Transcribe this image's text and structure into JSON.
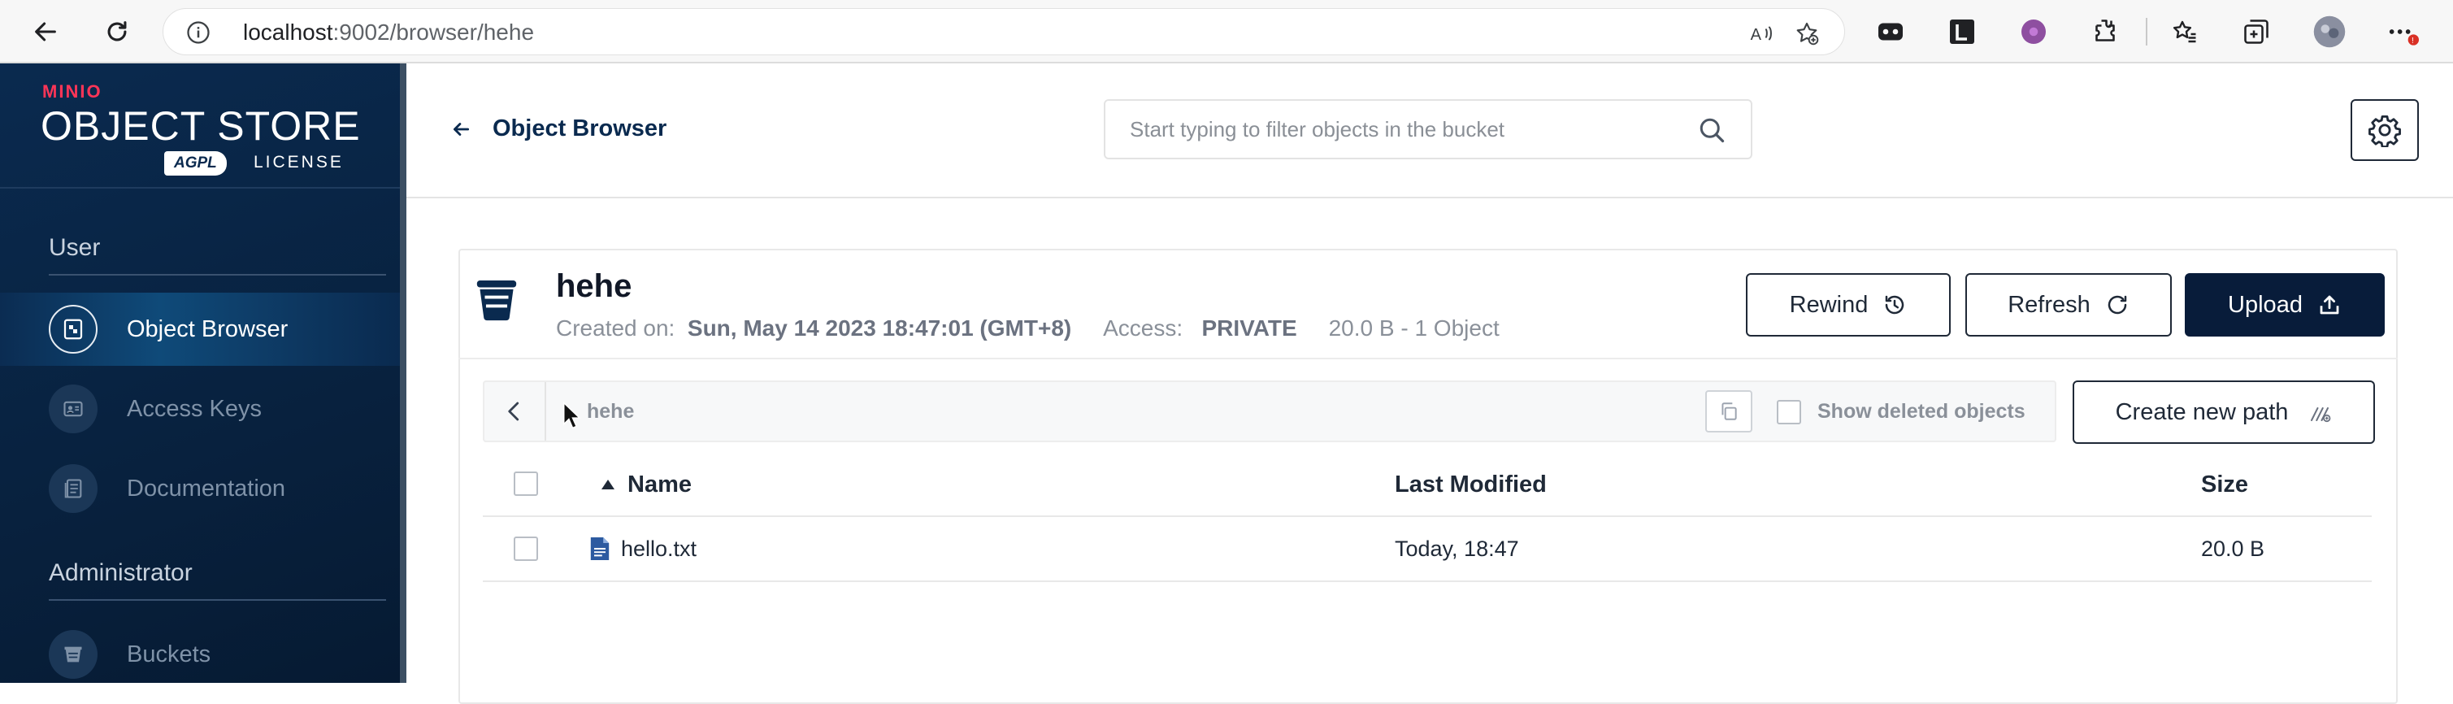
{
  "browser": {
    "url_host": "localhost",
    "url_rest": ":9002/browser/hehe"
  },
  "sidebar": {
    "logo_brand": "MIN",
    "logo_brand_accent": "IO",
    "logo_product": "OBJECT STORE",
    "logo_badge": "AGPL",
    "logo_license": "LICENSE",
    "sections": [
      {
        "title": "User",
        "items": [
          {
            "label": "Object Browser",
            "icon": "object-browser-icon",
            "active": true
          },
          {
            "label": "Access Keys",
            "icon": "access-keys-icon",
            "active": false
          },
          {
            "label": "Documentation",
            "icon": "documentation-icon",
            "active": false
          }
        ]
      },
      {
        "title": "Administrator",
        "items": [
          {
            "label": "Buckets",
            "icon": "buckets-icon",
            "active": false
          }
        ]
      }
    ]
  },
  "header": {
    "back_label": "Object Browser",
    "filter_placeholder": "Start typing to filter objects in the bucket",
    "filter_value": ""
  },
  "bucket": {
    "name": "hehe",
    "created_label": "Created on:",
    "created_value": "Sun, May 14 2023 18:47:01 (GMT+8)",
    "access_label": "Access:",
    "access_value": "PRIVATE",
    "usage": "20.0 B - 1 Object"
  },
  "actions": {
    "rewind": "Rewind",
    "refresh": "Refresh",
    "upload": "Upload",
    "create_path": "Create new path"
  },
  "breadcrumb": {
    "path": "hehe",
    "show_deleted_label": "Show deleted objects",
    "show_deleted_checked": false
  },
  "table": {
    "columns": [
      "Name",
      "Last Modified",
      "Size"
    ],
    "sort_column": "Name",
    "sort_direction": "ascending",
    "rows": [
      {
        "name": "hello.txt",
        "last_modified": "Today, 18:47",
        "size": "20.0 B"
      }
    ]
  },
  "colors": {
    "sidebar_bg": "#0a2a4f",
    "primary_dark": "#081c3a",
    "brand_red": "#ff3557"
  }
}
